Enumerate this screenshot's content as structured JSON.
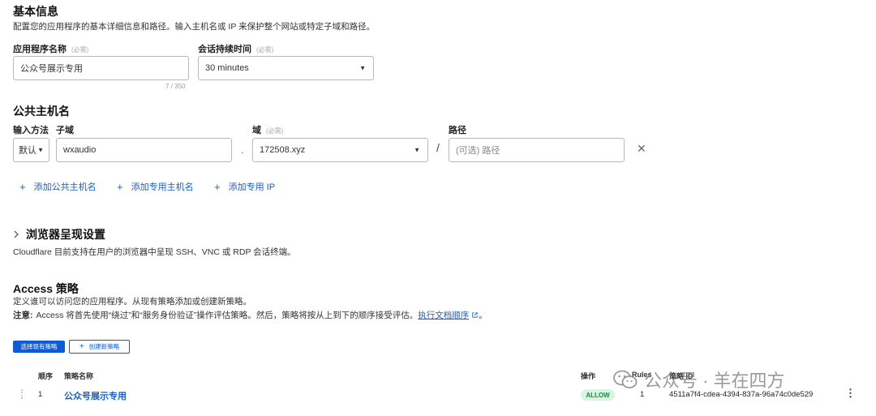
{
  "basic": {
    "title": "基本信息",
    "description": "配置您的应用程序的基本详细信息和路径。输入主机名或 IP 来保护整个网站或特定子域和路径。",
    "app_name_label": "应用程序名称",
    "app_name_required": "(必需)",
    "app_name_value": "公众号展示专用",
    "app_name_counter": "7 / 350",
    "session_label": "会话持续时间",
    "session_required": "(必需)",
    "session_value": "30 minutes"
  },
  "hostname": {
    "title": "公共主机名",
    "input_method_label": "输入方法",
    "subdomain_label": "子域",
    "domain_label": "域",
    "domain_required": "(必需)",
    "path_label": "路径",
    "input_method_value": "默认",
    "subdomain_value": "wxaudio",
    "dot": ".",
    "domain_value": "172508.xyz",
    "slash": "/",
    "path_placeholder": "(可选) 路径",
    "add_public": "添加公共主机名",
    "add_private": "添加专用主机名",
    "add_ip": "添加专用 IP"
  },
  "browser": {
    "title": "浏览器呈现设置",
    "description": "Cloudflare 目前支持在用户的浏览器中呈现 SSH、VNC 或 RDP 会话终端。"
  },
  "access": {
    "title": "Access 策略",
    "description": "定义谁可以访问您的应用程序。从现有策略添加或创建新策略。",
    "note_label": "注意:",
    "note_text": "Access 将首先使用“绕过”和“服务身份验证”操作评估策略。然后，策略将按从上到下的顺序接受评估。",
    "note_link": "执行文档顺序",
    "note_end": "。",
    "select_button": "选择现有策略",
    "create_button": "创建新策略",
    "columns": {
      "order": "顺序",
      "name": "策略名称",
      "action": "操作",
      "rules": "Rules",
      "policy_id": "策略 ID"
    },
    "rows": [
      {
        "order": "1",
        "name": "公众号展示专用",
        "action": "ALLOW",
        "rules": "1",
        "policy_id": "4511a7f4-cdea-4394-837a-96a74c0de529"
      }
    ]
  },
  "watermark": {
    "text": "公众号 · 羊在四方"
  },
  "colors": {
    "accent": "#0d5bd8",
    "link": "#1a5ec8",
    "allow_bg": "#d9f5e2",
    "allow_text": "#178c43"
  }
}
